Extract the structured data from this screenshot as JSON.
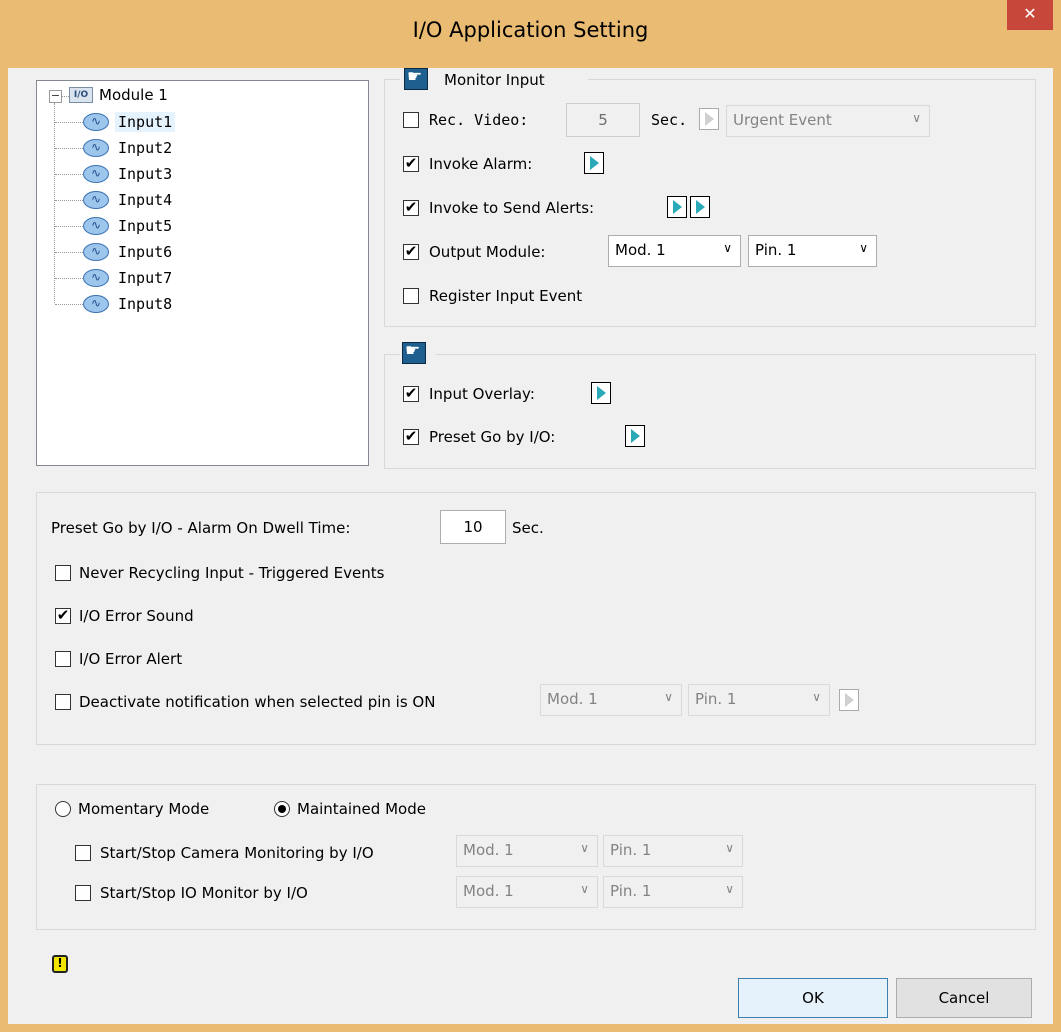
{
  "window": {
    "title": "I/O Application Setting",
    "close_label": "✕"
  },
  "tree": {
    "module_label": "Module 1",
    "inputs": [
      "Input1",
      "Input2",
      "Input3",
      "Input4",
      "Input5",
      "Input6",
      "Input7",
      "Input8"
    ],
    "selected_index": 0
  },
  "monitor_input": {
    "group_title": "Monitor Input",
    "rec_video": {
      "label": "Rec. Video:",
      "checked": false,
      "seconds": "5",
      "sec_label": "Sec.",
      "event": "Urgent Event"
    },
    "invoke_alarm": {
      "label": "Invoke Alarm:",
      "checked": true
    },
    "invoke_alerts": {
      "label": "Invoke to Send Alerts:",
      "checked": true
    },
    "output_module": {
      "label": "Output Module:",
      "checked": true,
      "module": "Mod. 1",
      "pin": "Pin. 1"
    },
    "register_input_event": {
      "label": "Register Input Event",
      "checked": false
    }
  },
  "overlay_group": {
    "input_overlay": {
      "label": "Input Overlay:",
      "checked": true
    },
    "preset_go": {
      "label": "Preset Go by I/O:",
      "checked": true
    }
  },
  "general": {
    "dwell_label": "Preset Go by I/O - Alarm On Dwell Time:",
    "dwell_value": "10",
    "dwell_unit": "Sec.",
    "never_recycling": {
      "label": "Never Recycling Input - Triggered Events",
      "checked": false
    },
    "error_sound": {
      "label": "I/O Error Sound",
      "checked": true
    },
    "error_alert": {
      "label": "I/O Error Alert",
      "checked": false
    },
    "deactivate": {
      "label": "Deactivate notification when selected pin is ON",
      "checked": false,
      "module": "Mod. 1",
      "pin": "Pin. 1"
    }
  },
  "mode": {
    "momentary_label": "Momentary Mode",
    "maintained_label": "Maintained Mode",
    "selected": "maintained",
    "camera_monitoring": {
      "label": "Start/Stop Camera Monitoring by I/O",
      "checked": false,
      "module": "Mod. 1",
      "pin": "Pin. 1"
    },
    "io_monitor": {
      "label": "Start/Stop IO Monitor by I/O",
      "checked": false,
      "module": "Mod. 1",
      "pin": "Pin. 1"
    }
  },
  "buttons": {
    "ok": "OK",
    "cancel": "Cancel"
  },
  "colors": {
    "title_bar": "#eabb72",
    "close_button": "#c7483a",
    "play_arrow": "#2aa9b8",
    "hand_icon": "#1e5f8f",
    "warning_icon": "#f2e600"
  },
  "check_glyph": "✔",
  "arrow_glyph": "∨"
}
